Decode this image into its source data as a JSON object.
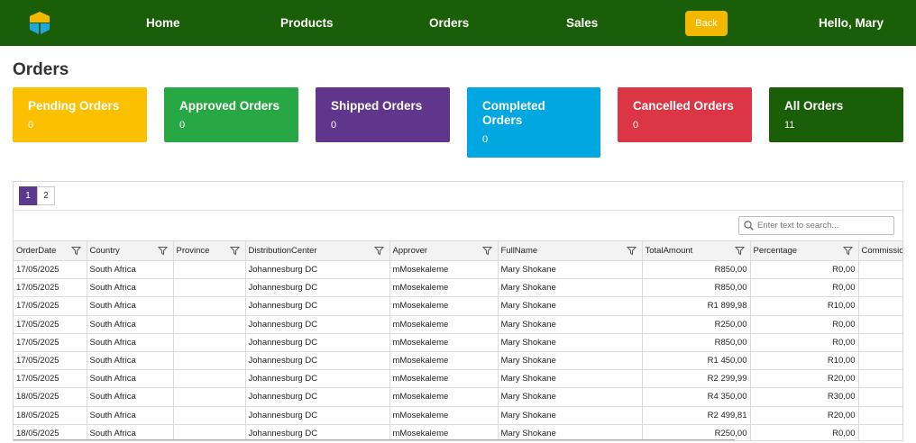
{
  "nav": {
    "home": "Home",
    "products": "Products",
    "orders": "Orders",
    "sales": "Sales",
    "back": "Back",
    "greeting": "Hello, Mary"
  },
  "page": {
    "title": "Orders"
  },
  "cards": [
    {
      "label": "Pending Orders",
      "count": "0",
      "color": "#fbc100"
    },
    {
      "label": "Approved Orders",
      "count": "0",
      "color": "#27a844"
    },
    {
      "label": "Shipped Orders",
      "count": "0",
      "color": "#5f368c"
    },
    {
      "label": "Completed Orders",
      "count": "0",
      "color": "#00a7e1"
    },
    {
      "label": "Cancelled Orders",
      "count": "0",
      "color": "#dc3545"
    },
    {
      "label": "All Orders",
      "count": "11",
      "color": "#1b5e08"
    }
  ],
  "grid": {
    "pages": [
      "1",
      "2"
    ],
    "search_placeholder": "Enter text to search...",
    "columns": [
      "OrderDate",
      "Country",
      "Province",
      "DistributionCenter",
      "Approver",
      "FullName",
      "TotalAmount",
      "Percentage",
      "Commissio"
    ],
    "rows": [
      [
        "17/05/2025",
        "South Africa",
        "",
        "Johannesburg DC",
        "mMosekaleme",
        "Mary Shokane",
        "R850,00",
        "R0,00",
        ""
      ],
      [
        "17/05/2025",
        "South Africa",
        "",
        "Johannesburg DC",
        "mMosekaleme",
        "Mary Shokane",
        "R850,00",
        "R0,00",
        ""
      ],
      [
        "17/05/2025",
        "South Africa",
        "",
        "Johannesburg DC",
        "mMosekaleme",
        "Mary Shokane",
        "R1 899,98",
        "R10,00",
        ""
      ],
      [
        "17/05/2025",
        "South Africa",
        "",
        "Johannesburg DC",
        "mMosekaleme",
        "Mary Shokane",
        "R250,00",
        "R0,00",
        ""
      ],
      [
        "17/05/2025",
        "South Africa",
        "",
        "Johannesburg DC",
        "mMosekaleme",
        "Mary Shokane",
        "R850,00",
        "R0,00",
        ""
      ],
      [
        "17/05/2025",
        "South Africa",
        "",
        "Johannesburg DC",
        "mMosekaleme",
        "Mary Shokane",
        "R1 450,00",
        "R10,00",
        ""
      ],
      [
        "17/05/2025",
        "South Africa",
        "",
        "Johannesburg DC",
        "mMosekaleme",
        "Mary Shokane",
        "R2 299,99",
        "R20,00",
        ""
      ],
      [
        "18/05/2025",
        "South Africa",
        "",
        "Johannesburg DC",
        "mMosekaleme",
        "Mary Shokane",
        "R4 350,00",
        "R30,00",
        ""
      ],
      [
        "18/05/2025",
        "South Africa",
        "",
        "Johannesburg DC",
        "mMosekaleme",
        "Mary Shokane",
        "R2 499,81",
        "R20,00",
        ""
      ],
      [
        "18/05/2025",
        "South Africa",
        "",
        "Johannesburg DC",
        "mMosekaleme",
        "Mary Shokane",
        "R250,00",
        "R0,00",
        ""
      ]
    ]
  }
}
